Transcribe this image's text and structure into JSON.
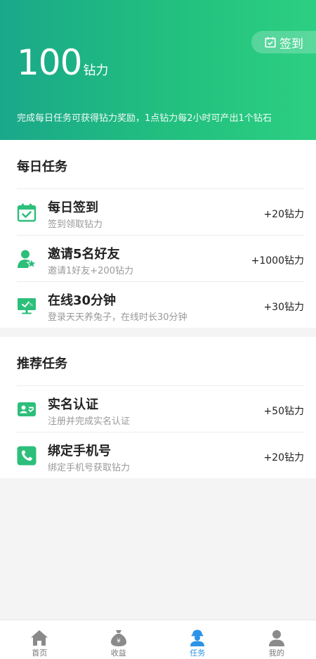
{
  "header": {
    "checkin_label": "签到",
    "points_value": "100",
    "points_unit": "钻力",
    "description": "完成每日任务可获得钻力奖励，1点钻力每2小时可产出1个钻石"
  },
  "daily": {
    "title": "每日任务",
    "tasks": [
      {
        "title": "每日签到",
        "subtitle": "签到领取钻力",
        "reward": "+20钻力",
        "icon": "calendar-check-icon"
      },
      {
        "title": "邀请5名好友",
        "subtitle": "邀请1好友+200钻力",
        "reward": "+1000钻力",
        "icon": "user-star-icon"
      },
      {
        "title": "在线30分钟",
        "subtitle": "登录天天养兔子，在线时长30分钟",
        "reward": "+30钻力",
        "icon": "monitor-icon"
      }
    ]
  },
  "recommended": {
    "title": "推荐任务",
    "tasks": [
      {
        "title": "实名认证",
        "subtitle": "注册并完成实名认证",
        "reward": "+50钻力",
        "icon": "id-card-icon"
      },
      {
        "title": "绑定手机号",
        "subtitle": "绑定手机号获取钻力",
        "reward": "+20钻力",
        "icon": "phone-icon"
      }
    ]
  },
  "tabbar": {
    "items": [
      {
        "label": "首页",
        "icon": "home-icon",
        "active": false
      },
      {
        "label": "收益",
        "icon": "money-bag-icon",
        "active": false
      },
      {
        "label": "任务",
        "icon": "worker-icon",
        "active": true
      },
      {
        "label": "我的",
        "icon": "profile-icon",
        "active": false
      }
    ]
  },
  "colors": {
    "brand_green": "#22c07f",
    "icon_green": "#2cbf7a",
    "active_blue": "#2a93e8",
    "inactive_gray": "#8a8a8a"
  }
}
